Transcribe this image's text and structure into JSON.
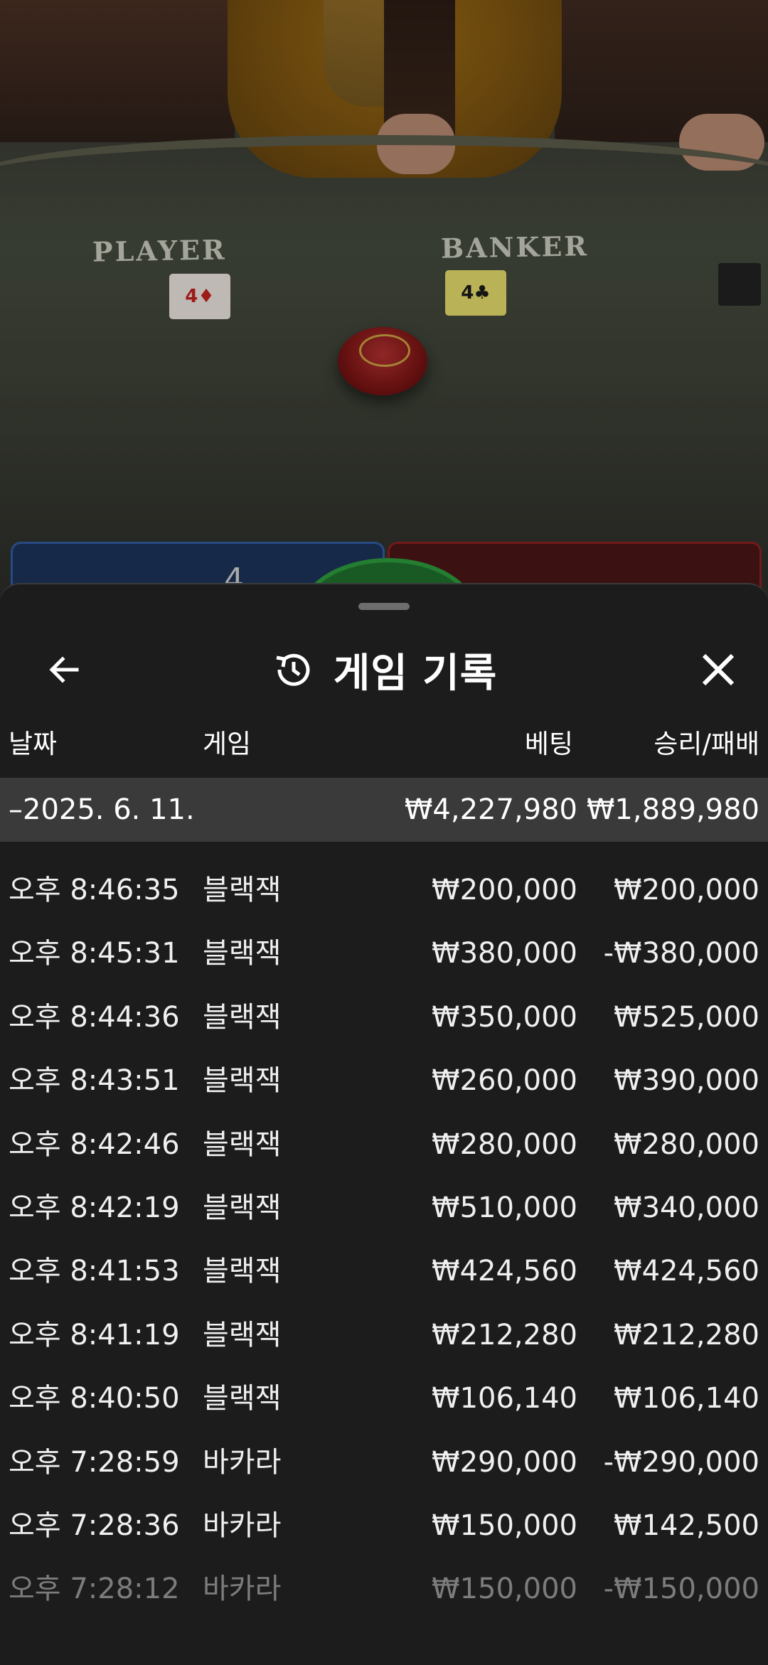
{
  "video": {
    "player_label": "PLAYER",
    "banker_label": "BANKER",
    "player_card": "4♦",
    "banker_card": "4♣",
    "bet_area_number": "4"
  },
  "sheet": {
    "title": "게임 기록",
    "back_icon": "arrow-left-icon",
    "history_icon": "history-icon",
    "close_icon": "close-icon"
  },
  "columns": {
    "date": "날짜",
    "game": "게임",
    "bet": "베팅",
    "win_loss": "승리/패배"
  },
  "summary": {
    "date": "–2025. 6. 11.",
    "bet": "₩4,227,980",
    "win_loss": "₩1,889,980"
  },
  "rows": [
    {
      "time": "오후 8:46:35",
      "game": "블랙잭",
      "bet": "₩200,000",
      "win_loss": "₩200,000"
    },
    {
      "time": "오후 8:45:31",
      "game": "블랙잭",
      "bet": "₩380,000",
      "win_loss": "-₩380,000"
    },
    {
      "time": "오후 8:44:36",
      "game": "블랙잭",
      "bet": "₩350,000",
      "win_loss": "₩525,000"
    },
    {
      "time": "오후 8:43:51",
      "game": "블랙잭",
      "bet": "₩260,000",
      "win_loss": "₩390,000"
    },
    {
      "time": "오후 8:42:46",
      "game": "블랙잭",
      "bet": "₩280,000",
      "win_loss": "₩280,000"
    },
    {
      "time": "오후 8:42:19",
      "game": "블랙잭",
      "bet": "₩510,000",
      "win_loss": "₩340,000"
    },
    {
      "time": "오후 8:41:53",
      "game": "블랙잭",
      "bet": "₩424,560",
      "win_loss": "₩424,560"
    },
    {
      "time": "오후 8:41:19",
      "game": "블랙잭",
      "bet": "₩212,280",
      "win_loss": "₩212,280"
    },
    {
      "time": "오후 8:40:50",
      "game": "블랙잭",
      "bet": "₩106,140",
      "win_loss": "₩106,140"
    },
    {
      "time": "오후 7:28:59",
      "game": "바카라",
      "bet": "₩290,000",
      "win_loss": "-₩290,000"
    },
    {
      "time": "오후 7:28:36",
      "game": "바카라",
      "bet": "₩150,000",
      "win_loss": "₩142,500"
    },
    {
      "time": "오후 7:28:12",
      "game": "바카라",
      "bet": "₩150,000",
      "win_loss": "-₩150,000"
    }
  ]
}
